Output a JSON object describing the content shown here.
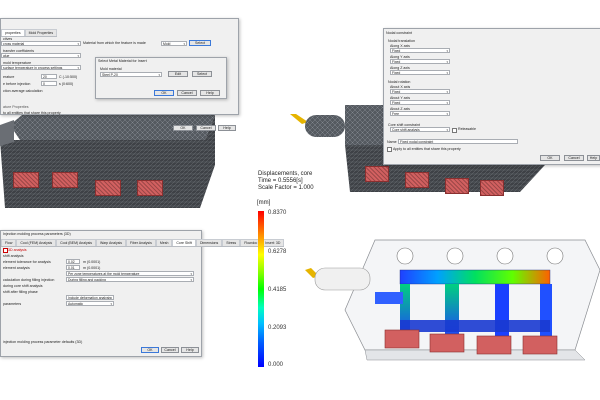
{
  "dialog_left": {
    "tabs": [
      "properties",
      "Mold Properties"
    ],
    "fields": [
      {
        "label": "ctives",
        "value": ""
      },
      {
        "label": "",
        "value": "cross material"
      },
      {
        "label": "transfer coefficients",
        "value": ""
      },
      {
        "label": "",
        "value": "alue"
      },
      {
        "label": "mold temperature",
        "value": ""
      },
      {
        "label": "",
        "value": "surface temperature in process settings"
      },
      {
        "label": "erature",
        "value": "20"
      },
      {
        "label": "e before injection",
        "value": "0"
      },
      {
        "label": "ction average calculation",
        "value": ""
      }
    ],
    "unit_1": "C (-10:500)",
    "unit_2": "s (0:600)",
    "material_label": "Material from which the feature is made",
    "material_value": "Mold",
    "select_button": "Select",
    "section_label": "ature Properties",
    "apply_text": "to all entities that share this property",
    "ok": "OK",
    "cancel": "Cancel",
    "help": "Help"
  },
  "dialog_select": {
    "title": "Select Metal Material for Insert",
    "label": "Mold material",
    "value": "Steel P-20",
    "edit_button": "Edit",
    "select_button": "Select",
    "ok": "OK",
    "cancel": "Cancel",
    "help": "Help"
  },
  "dialog_right": {
    "title": "Nodal constraint",
    "translation_label": "Nodal translation",
    "along_x": "Along X axis",
    "along_y": "Along Y axis",
    "along_z": "Along Z axis",
    "rotation_label": "Nodal rotation",
    "about_x": "About X axis",
    "about_y": "About Y axis",
    "about_z": "About Z axis",
    "value": "Fixed",
    "free_value": "Free",
    "cool_constraint": "Core shift constraint",
    "cool_value": "Core shift analysis",
    "releasable": "Releasable",
    "name_label": "Name",
    "name_value": "Fixed nodal constraint",
    "apply_text": "Apply to all entities that share this property",
    "ok": "OK",
    "cancel": "Cancel",
    "help": "Help"
  },
  "dialog_bottom": {
    "title": "Injection molding process parameters (3D)",
    "tabs": [
      "Flow",
      "Cool (FEM) Analysis",
      "Cool (BEM) Analysis",
      "Warp Analysis",
      "Fiber Analysis",
      "Mesh",
      "Core Shift",
      "Dimensions",
      "Stress",
      "Flowdoc",
      "Insert: 3D"
    ],
    "checkbox_label": "3D analysis",
    "rows": [
      {
        "label": "shift analysis",
        "value": ""
      },
      {
        "label": "element tolerance for analysis",
        "value": "0.02"
      },
      {
        "label": "element analysis",
        "value": "0.01"
      },
      {
        "label": "",
        "value": "Per zone temperatures at the mold temperature"
      },
      {
        "label": "calculation during filling injection",
        "value": "During filling and packing"
      },
      {
        "label": "during core shift analysis",
        "value": ""
      },
      {
        "label": "shift after filling phase",
        "value": ""
      },
      {
        "label": "",
        "value": "Include deformation analysis"
      },
      {
        "label": "parameters",
        "value": "Automatic"
      }
    ],
    "unit_1": "m (0.0001)",
    "unit_2": "m (0.0001)",
    "footer_text": "injection molding process parameter defaults (3D)",
    "ok": "OK",
    "cancel": "Cancel",
    "help": "Help"
  },
  "result": {
    "title": "Displacements, core",
    "time": "Time = 0.5556[s]",
    "scale": "Scale Factor = 1.000",
    "unit": "[mm]",
    "ticks": [
      "0.8370",
      "0.6278",
      "0.4185",
      "0.2093",
      "0.000"
    ]
  }
}
